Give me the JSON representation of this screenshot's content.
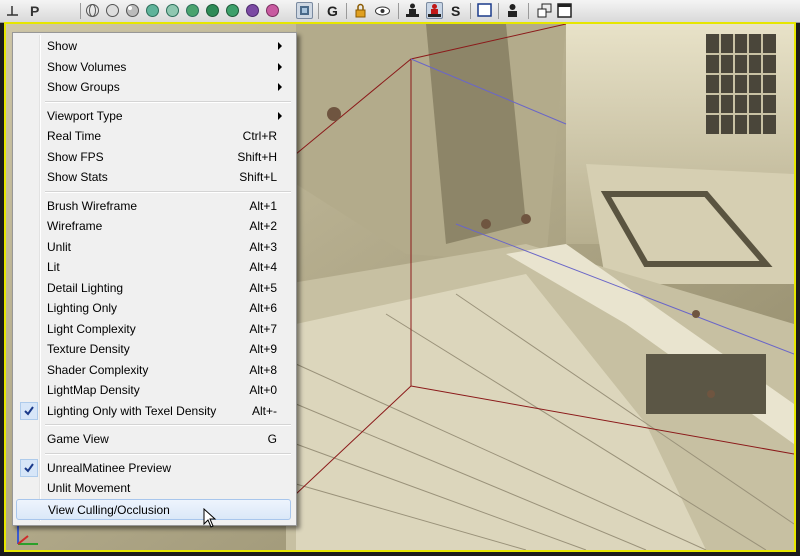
{
  "menu": {
    "items": [
      {
        "label": "Show",
        "shortcut": "",
        "submenu": true,
        "checked": false
      },
      {
        "label": "Show Volumes",
        "shortcut": "",
        "submenu": true,
        "checked": false
      },
      {
        "label": "Show Groups",
        "shortcut": "",
        "submenu": true,
        "checked": false
      },
      {
        "label": "Viewport Type",
        "shortcut": "",
        "submenu": true,
        "checked": false
      },
      {
        "label": "Real Time",
        "shortcut": "Ctrl+R",
        "submenu": false,
        "checked": false
      },
      {
        "label": "Show FPS",
        "shortcut": "Shift+H",
        "submenu": false,
        "checked": false
      },
      {
        "label": "Show Stats",
        "shortcut": "Shift+L",
        "submenu": false,
        "checked": false
      },
      {
        "label": "Brush Wireframe",
        "shortcut": "Alt+1",
        "submenu": false,
        "checked": false
      },
      {
        "label": "Wireframe",
        "shortcut": "Alt+2",
        "submenu": false,
        "checked": false
      },
      {
        "label": "Unlit",
        "shortcut": "Alt+3",
        "submenu": false,
        "checked": false
      },
      {
        "label": "Lit",
        "shortcut": "Alt+4",
        "submenu": false,
        "checked": false
      },
      {
        "label": "Detail Lighting",
        "shortcut": "Alt+5",
        "submenu": false,
        "checked": false
      },
      {
        "label": "Lighting Only",
        "shortcut": "Alt+6",
        "submenu": false,
        "checked": false
      },
      {
        "label": "Light Complexity",
        "shortcut": "Alt+7",
        "submenu": false,
        "checked": false
      },
      {
        "label": "Texture Density",
        "shortcut": "Alt+9",
        "submenu": false,
        "checked": false
      },
      {
        "label": "Shader Complexity",
        "shortcut": "Alt+8",
        "submenu": false,
        "checked": false
      },
      {
        "label": "LightMap Density",
        "shortcut": "Alt+0",
        "submenu": false,
        "checked": false
      },
      {
        "label": "Lighting Only with Texel Density",
        "shortcut": "Alt+-",
        "submenu": false,
        "checked": true
      },
      {
        "label": "Game View",
        "shortcut": "G",
        "submenu": false,
        "checked": false
      },
      {
        "label": "UnrealMatinee Preview",
        "shortcut": "",
        "submenu": false,
        "checked": true
      },
      {
        "label": "Unlit Movement",
        "shortcut": "",
        "submenu": false,
        "checked": false
      },
      {
        "label": "View Culling/Occlusion",
        "shortcut": "",
        "submenu": false,
        "checked": false,
        "highlighted": true
      }
    ]
  },
  "toolbar": {
    "buttons": [
      {
        "name": "viewport-options-icon"
      },
      {
        "name": "perspective-icon"
      },
      {
        "name": "wireframe-sphere-icon"
      },
      {
        "name": "unlit-sphere-icon"
      },
      {
        "name": "lit-sphere-icon"
      },
      {
        "name": "detail-lighting-icon"
      },
      {
        "name": "lighting-only-icon"
      },
      {
        "name": "light-complexity-icon"
      },
      {
        "name": "texture-density-icon"
      },
      {
        "name": "shader-complexity-icon"
      },
      {
        "name": "lightmap-density-icon"
      },
      {
        "name": "realtime-icon"
      },
      {
        "name": "game-view-icon",
        "text": "G"
      },
      {
        "name": "lock-icon"
      },
      {
        "name": "eye-icon"
      },
      {
        "name": "actor-icon"
      },
      {
        "name": "actor-highlighted-icon"
      },
      {
        "name": "streaming-icon",
        "text": "S"
      },
      {
        "name": "viewport-frame-icon"
      },
      {
        "name": "user-icon"
      },
      {
        "name": "float-viewport-icon"
      },
      {
        "name": "maximize-viewport-icon"
      }
    ],
    "colors": {
      "accent": "#e6e600",
      "highlight": "#dbe8f8",
      "frame_border": "#e6e600"
    }
  }
}
